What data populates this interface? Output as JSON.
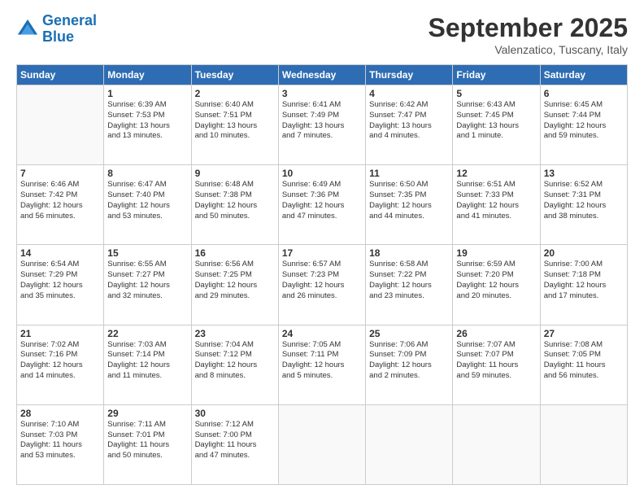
{
  "header": {
    "logo_line1": "General",
    "logo_line2": "Blue",
    "month": "September 2025",
    "location": "Valenzatico, Tuscany, Italy"
  },
  "weekdays": [
    "Sunday",
    "Monday",
    "Tuesday",
    "Wednesday",
    "Thursday",
    "Friday",
    "Saturday"
  ],
  "weeks": [
    [
      {
        "day": "",
        "info": ""
      },
      {
        "day": "1",
        "info": "Sunrise: 6:39 AM\nSunset: 7:53 PM\nDaylight: 13 hours\nand 13 minutes."
      },
      {
        "day": "2",
        "info": "Sunrise: 6:40 AM\nSunset: 7:51 PM\nDaylight: 13 hours\nand 10 minutes."
      },
      {
        "day": "3",
        "info": "Sunrise: 6:41 AM\nSunset: 7:49 PM\nDaylight: 13 hours\nand 7 minutes."
      },
      {
        "day": "4",
        "info": "Sunrise: 6:42 AM\nSunset: 7:47 PM\nDaylight: 13 hours\nand 4 minutes."
      },
      {
        "day": "5",
        "info": "Sunrise: 6:43 AM\nSunset: 7:45 PM\nDaylight: 13 hours\nand 1 minute."
      },
      {
        "day": "6",
        "info": "Sunrise: 6:45 AM\nSunset: 7:44 PM\nDaylight: 12 hours\nand 59 minutes."
      }
    ],
    [
      {
        "day": "7",
        "info": "Sunrise: 6:46 AM\nSunset: 7:42 PM\nDaylight: 12 hours\nand 56 minutes."
      },
      {
        "day": "8",
        "info": "Sunrise: 6:47 AM\nSunset: 7:40 PM\nDaylight: 12 hours\nand 53 minutes."
      },
      {
        "day": "9",
        "info": "Sunrise: 6:48 AM\nSunset: 7:38 PM\nDaylight: 12 hours\nand 50 minutes."
      },
      {
        "day": "10",
        "info": "Sunrise: 6:49 AM\nSunset: 7:36 PM\nDaylight: 12 hours\nand 47 minutes."
      },
      {
        "day": "11",
        "info": "Sunrise: 6:50 AM\nSunset: 7:35 PM\nDaylight: 12 hours\nand 44 minutes."
      },
      {
        "day": "12",
        "info": "Sunrise: 6:51 AM\nSunset: 7:33 PM\nDaylight: 12 hours\nand 41 minutes."
      },
      {
        "day": "13",
        "info": "Sunrise: 6:52 AM\nSunset: 7:31 PM\nDaylight: 12 hours\nand 38 minutes."
      }
    ],
    [
      {
        "day": "14",
        "info": "Sunrise: 6:54 AM\nSunset: 7:29 PM\nDaylight: 12 hours\nand 35 minutes."
      },
      {
        "day": "15",
        "info": "Sunrise: 6:55 AM\nSunset: 7:27 PM\nDaylight: 12 hours\nand 32 minutes."
      },
      {
        "day": "16",
        "info": "Sunrise: 6:56 AM\nSunset: 7:25 PM\nDaylight: 12 hours\nand 29 minutes."
      },
      {
        "day": "17",
        "info": "Sunrise: 6:57 AM\nSunset: 7:23 PM\nDaylight: 12 hours\nand 26 minutes."
      },
      {
        "day": "18",
        "info": "Sunrise: 6:58 AM\nSunset: 7:22 PM\nDaylight: 12 hours\nand 23 minutes."
      },
      {
        "day": "19",
        "info": "Sunrise: 6:59 AM\nSunset: 7:20 PM\nDaylight: 12 hours\nand 20 minutes."
      },
      {
        "day": "20",
        "info": "Sunrise: 7:00 AM\nSunset: 7:18 PM\nDaylight: 12 hours\nand 17 minutes."
      }
    ],
    [
      {
        "day": "21",
        "info": "Sunrise: 7:02 AM\nSunset: 7:16 PM\nDaylight: 12 hours\nand 14 minutes."
      },
      {
        "day": "22",
        "info": "Sunrise: 7:03 AM\nSunset: 7:14 PM\nDaylight: 12 hours\nand 11 minutes."
      },
      {
        "day": "23",
        "info": "Sunrise: 7:04 AM\nSunset: 7:12 PM\nDaylight: 12 hours\nand 8 minutes."
      },
      {
        "day": "24",
        "info": "Sunrise: 7:05 AM\nSunset: 7:11 PM\nDaylight: 12 hours\nand 5 minutes."
      },
      {
        "day": "25",
        "info": "Sunrise: 7:06 AM\nSunset: 7:09 PM\nDaylight: 12 hours\nand 2 minutes."
      },
      {
        "day": "26",
        "info": "Sunrise: 7:07 AM\nSunset: 7:07 PM\nDaylight: 11 hours\nand 59 minutes."
      },
      {
        "day": "27",
        "info": "Sunrise: 7:08 AM\nSunset: 7:05 PM\nDaylight: 11 hours\nand 56 minutes."
      }
    ],
    [
      {
        "day": "28",
        "info": "Sunrise: 7:10 AM\nSunset: 7:03 PM\nDaylight: 11 hours\nand 53 minutes."
      },
      {
        "day": "29",
        "info": "Sunrise: 7:11 AM\nSunset: 7:01 PM\nDaylight: 11 hours\nand 50 minutes."
      },
      {
        "day": "30",
        "info": "Sunrise: 7:12 AM\nSunset: 7:00 PM\nDaylight: 11 hours\nand 47 minutes."
      },
      {
        "day": "",
        "info": ""
      },
      {
        "day": "",
        "info": ""
      },
      {
        "day": "",
        "info": ""
      },
      {
        "day": "",
        "info": ""
      }
    ]
  ]
}
